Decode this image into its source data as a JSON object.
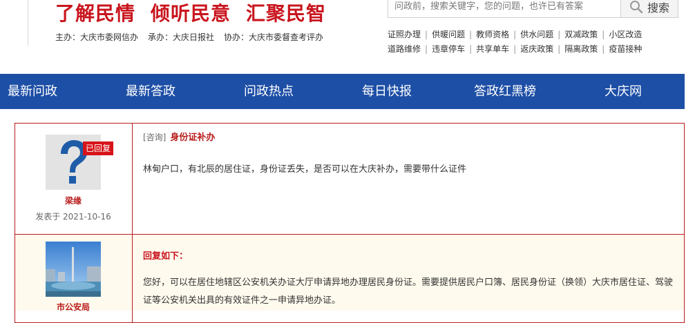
{
  "header": {
    "slogan": [
      "了解民情",
      "倾听民意",
      "汇聚民智"
    ],
    "sponsors": [
      "主办：大庆市委网信办",
      "承办：大庆日报社",
      "协办：大庆市委督查考评办"
    ],
    "search": {
      "placeholder": "问政前，搜索关键字，您的问题，也许已有答案",
      "button_label": "搜索",
      "button_icon": "search-icon"
    },
    "hot_tags_row1": [
      "证照办理",
      "供暖问题",
      "教师资格",
      "供水问题",
      "双减政策",
      "小区改造"
    ],
    "hot_tags_row2": [
      "道路维修",
      "违章停车",
      "共享单车",
      "返庆政策",
      "隔离政策",
      "疫苗接种"
    ]
  },
  "nav": {
    "items": [
      "最新问政",
      "最新答政",
      "问政热点",
      "每日快报",
      "答政红黑榜",
      "大庆网"
    ]
  },
  "question": {
    "avatar_icon": "question-mark-avatar",
    "status_badge": "已回复",
    "user_name": "梁缘",
    "posted_date": "发表于 2021-10-16",
    "type": "[咨询]",
    "title": "身份证补办",
    "content": "林甸户口，有北辰的居住证，身份证丢失，是否可以在大庆补办，需要带什么证件"
  },
  "reply": {
    "agency_name": "市公安局",
    "header": "回复如下：",
    "content": "您好，可以在居住地辖区公安机关办证大厅申请异地办理居民身份证。需要提供居民户口簿、居民身份证（换领）大庆市居住证、驾驶证等公安机关出具的有效证件之一申请异地办证。"
  },
  "colors": {
    "brand_red": "#c9151e",
    "nav_blue": "#1e4fa6",
    "reply_bg": "#fffaee"
  }
}
